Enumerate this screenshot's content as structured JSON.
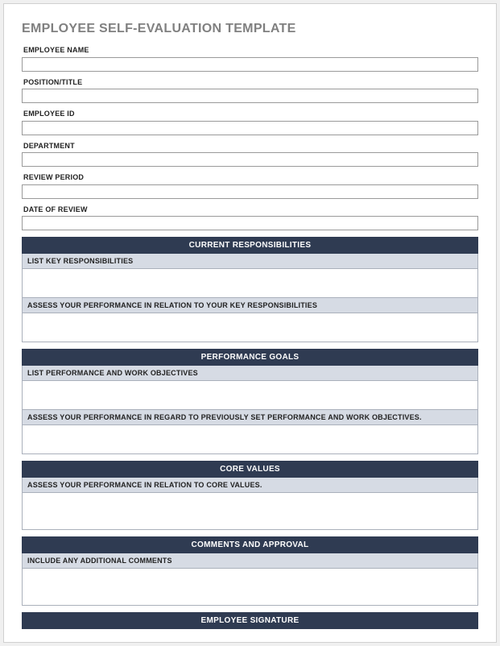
{
  "title": "EMPLOYEE SELF-EVALUATION TEMPLATE",
  "fields": {
    "employee_name": {
      "label": "EMPLOYEE NAME",
      "value": ""
    },
    "position_title": {
      "label": "POSITION/TITLE",
      "value": ""
    },
    "employee_id": {
      "label": "EMPLOYEE ID",
      "value": ""
    },
    "department": {
      "label": "DEPARTMENT",
      "value": ""
    },
    "review_period": {
      "label": "REVIEW PERIOD",
      "value": ""
    },
    "date_of_review": {
      "label": "DATE OF REVIEW",
      "value": ""
    }
  },
  "sections": {
    "current_responsibilities": {
      "header": "CURRENT RESPONSIBILITIES",
      "sub1": "LIST KEY RESPONSIBILITIES",
      "val1": "",
      "sub2": "ASSESS YOUR PERFORMANCE IN RELATION TO YOUR KEY RESPONSIBILITIES",
      "val2": ""
    },
    "performance_goals": {
      "header": "PERFORMANCE GOALS",
      "sub1": "LIST PERFORMANCE AND WORK OBJECTIVES",
      "val1": "",
      "sub2": "ASSESS YOUR PERFORMANCE IN REGARD TO PREVIOUSLY SET PERFORMANCE AND WORK OBJECTIVES.",
      "val2": ""
    },
    "core_values": {
      "header": "CORE VALUES",
      "sub1": "ASSESS YOUR PERFORMANCE IN RELATION TO CORE VALUES.",
      "val1": ""
    },
    "comments_approval": {
      "header": "COMMENTS AND APPROVAL",
      "sub1": "INCLUDE ANY ADDITIONAL COMMENTS",
      "val1": ""
    },
    "employee_signature": {
      "header": "EMPLOYEE SIGNATURE"
    }
  }
}
